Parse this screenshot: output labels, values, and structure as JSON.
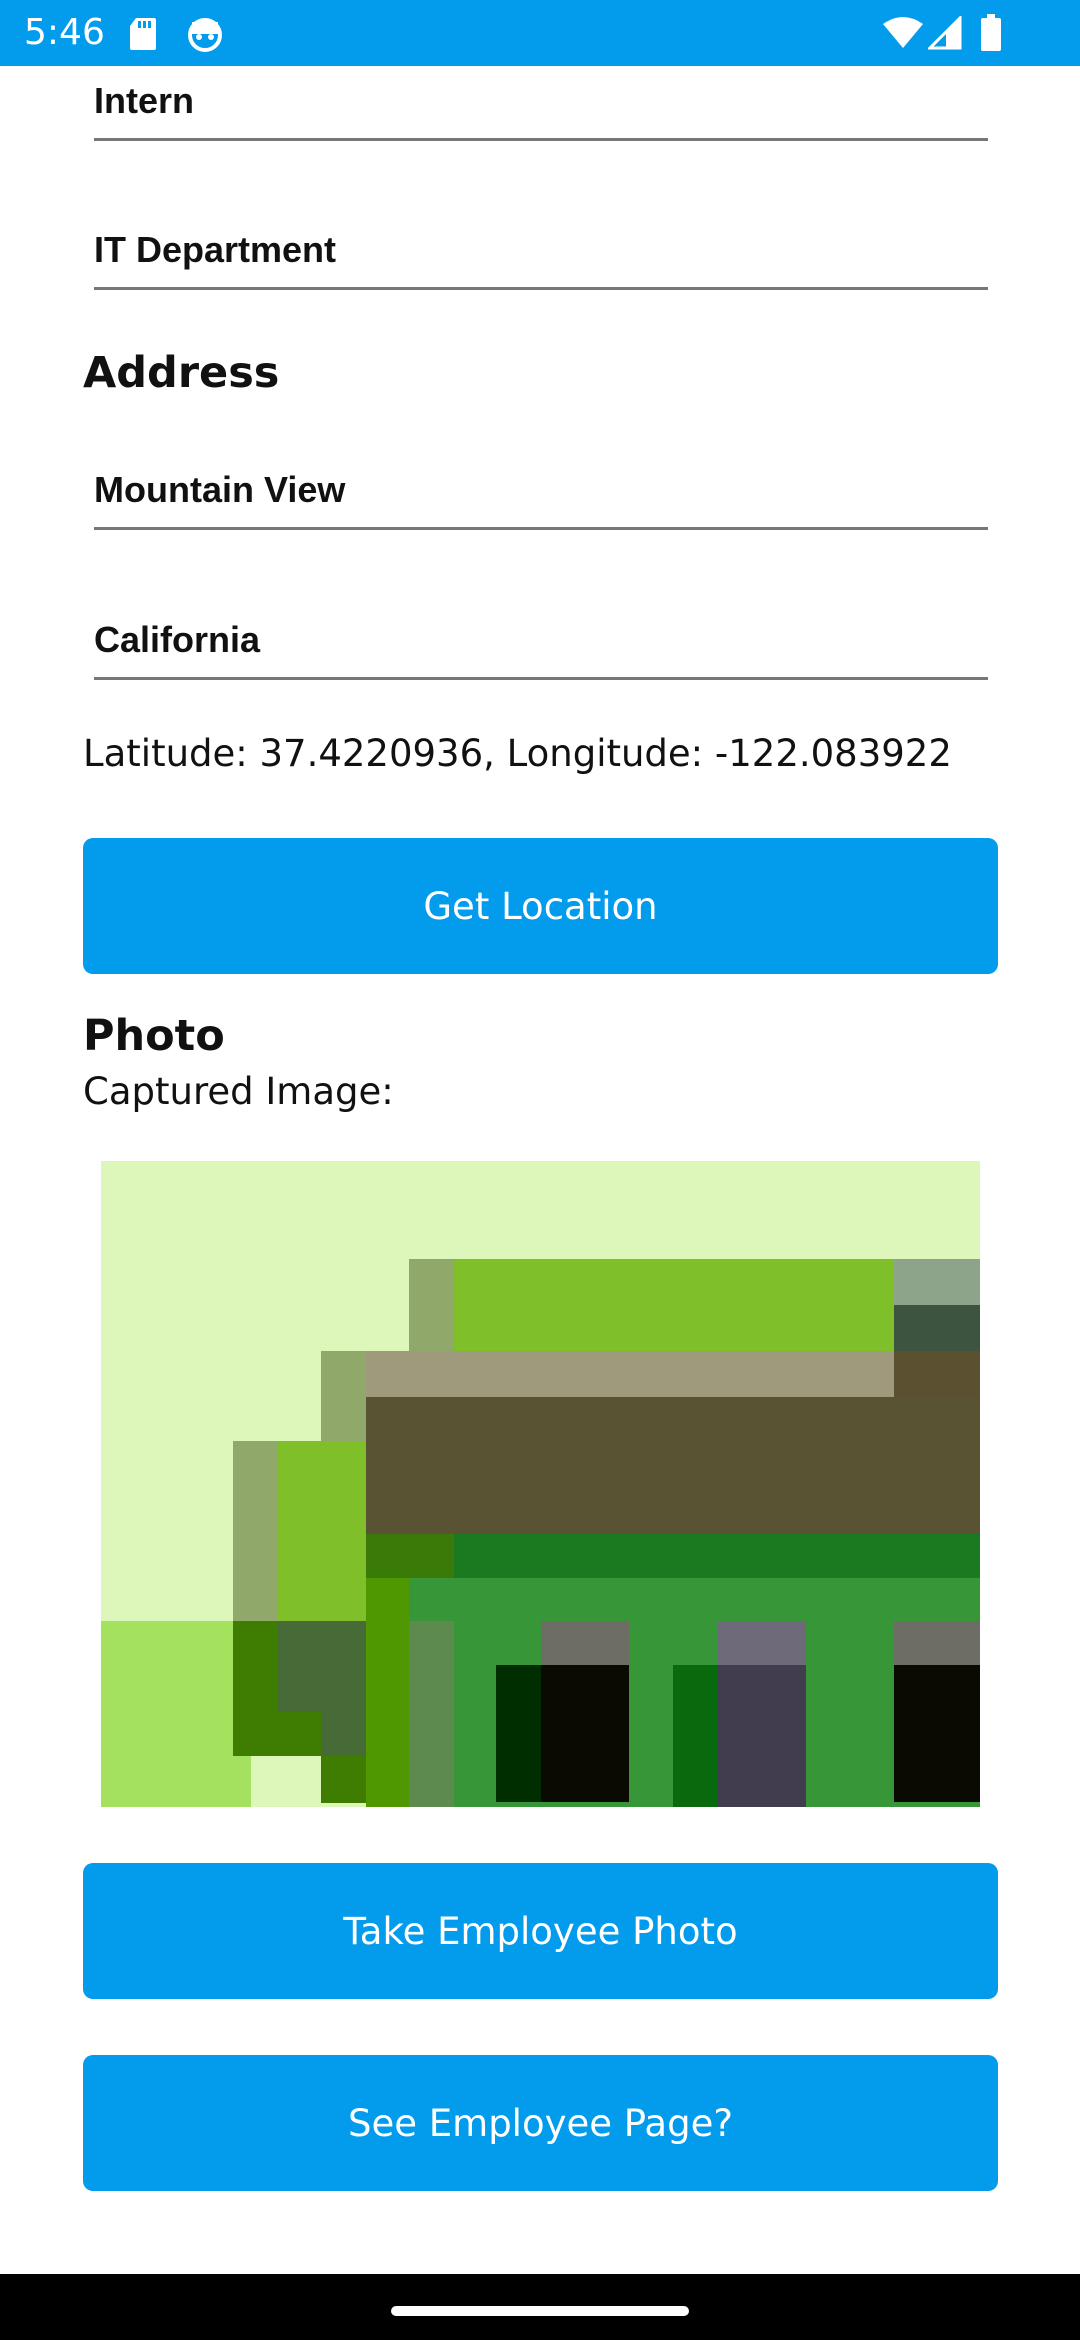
{
  "status_bar": {
    "time": "5:46",
    "icons": [
      "sd-card-icon",
      "android-debug-icon",
      "wifi-icon",
      "cell-signal-icon",
      "battery-icon"
    ]
  },
  "form": {
    "job_title": "Intern",
    "department": "IT Department",
    "address_heading": "Address",
    "city": "Mountain View",
    "state": "California",
    "location_text": "Latitude: 37.4220936, Longitude: -122.083922"
  },
  "buttons": {
    "get_location": "Get Location",
    "take_photo": "Take Employee Photo",
    "see_employee_page": "See Employee Page?"
  },
  "photo": {
    "heading": "Photo",
    "caption": "Captured Image:"
  },
  "colors": {
    "accent": "#039ced",
    "nav_bar": "#000000"
  }
}
